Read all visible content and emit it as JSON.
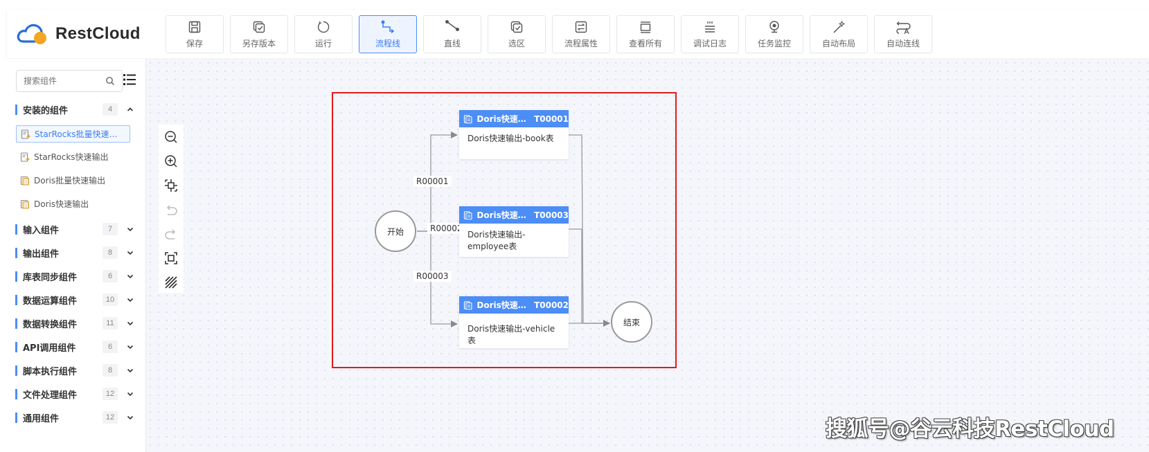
{
  "app": {
    "logo_text": "RestCloud",
    "colors": {
      "accent": "#4c8df6",
      "selection": "#e01a1a"
    }
  },
  "toolbar": [
    {
      "label": "保存",
      "icon": "save-icon",
      "active": false
    },
    {
      "label": "另存版本",
      "icon": "save-version-icon",
      "active": false
    },
    {
      "label": "运行",
      "icon": "run-icon",
      "active": false
    },
    {
      "label": "流程线",
      "icon": "flow-line-icon",
      "active": true
    },
    {
      "label": "直线",
      "icon": "straight-line-icon",
      "active": false
    },
    {
      "label": "选区",
      "icon": "select-area-icon",
      "active": false
    },
    {
      "label": "流程属性",
      "icon": "flow-properties-icon",
      "active": false
    },
    {
      "label": "查看所有",
      "icon": "view-all-icon",
      "active": false
    },
    {
      "label": "调试日志",
      "icon": "debug-log-icon",
      "active": false
    },
    {
      "label": "任务监控",
      "icon": "task-monitor-icon",
      "active": false
    },
    {
      "label": "自动布局",
      "icon": "auto-layout-icon",
      "active": false
    },
    {
      "label": "自动连线",
      "icon": "auto-connect-icon",
      "active": false
    }
  ],
  "sidebar": {
    "search_placeholder": "搜索组件",
    "installed": {
      "name": "安装的组件",
      "count": "4",
      "items": [
        "StarRocks批量快速…",
        "StarRocks快速输出",
        "Doris批量快速输出",
        "Doris快速输出"
      ]
    },
    "categories": [
      {
        "name": "输入组件",
        "count": "7"
      },
      {
        "name": "输出组件",
        "count": "8"
      },
      {
        "name": "库表同步组件",
        "count": "6"
      },
      {
        "name": "数据运算组件",
        "count": "10"
      },
      {
        "name": "数据转换组件",
        "count": "11"
      },
      {
        "name": "API调用组件",
        "count": "6"
      },
      {
        "name": "脚本执行组件",
        "count": "8"
      },
      {
        "name": "文件处理组件",
        "count": "12"
      },
      {
        "name": "通用组件",
        "count": "12"
      }
    ]
  },
  "flow": {
    "start": "开始",
    "end": "结束",
    "nodes": [
      {
        "title": "Doris快速…",
        "code": "T00001",
        "body": "Doris快速输出-book表"
      },
      {
        "title": "Doris快速…",
        "code": "T00003",
        "body": "Doris快速输出-employee表"
      },
      {
        "title": "Doris快速…",
        "code": "T00002",
        "body": "Doris快速输出-vehicle表"
      }
    ],
    "edges": [
      "R00001",
      "R00002",
      "R00003"
    ]
  },
  "watermark": "搜狐号@谷云科技RestCloud"
}
